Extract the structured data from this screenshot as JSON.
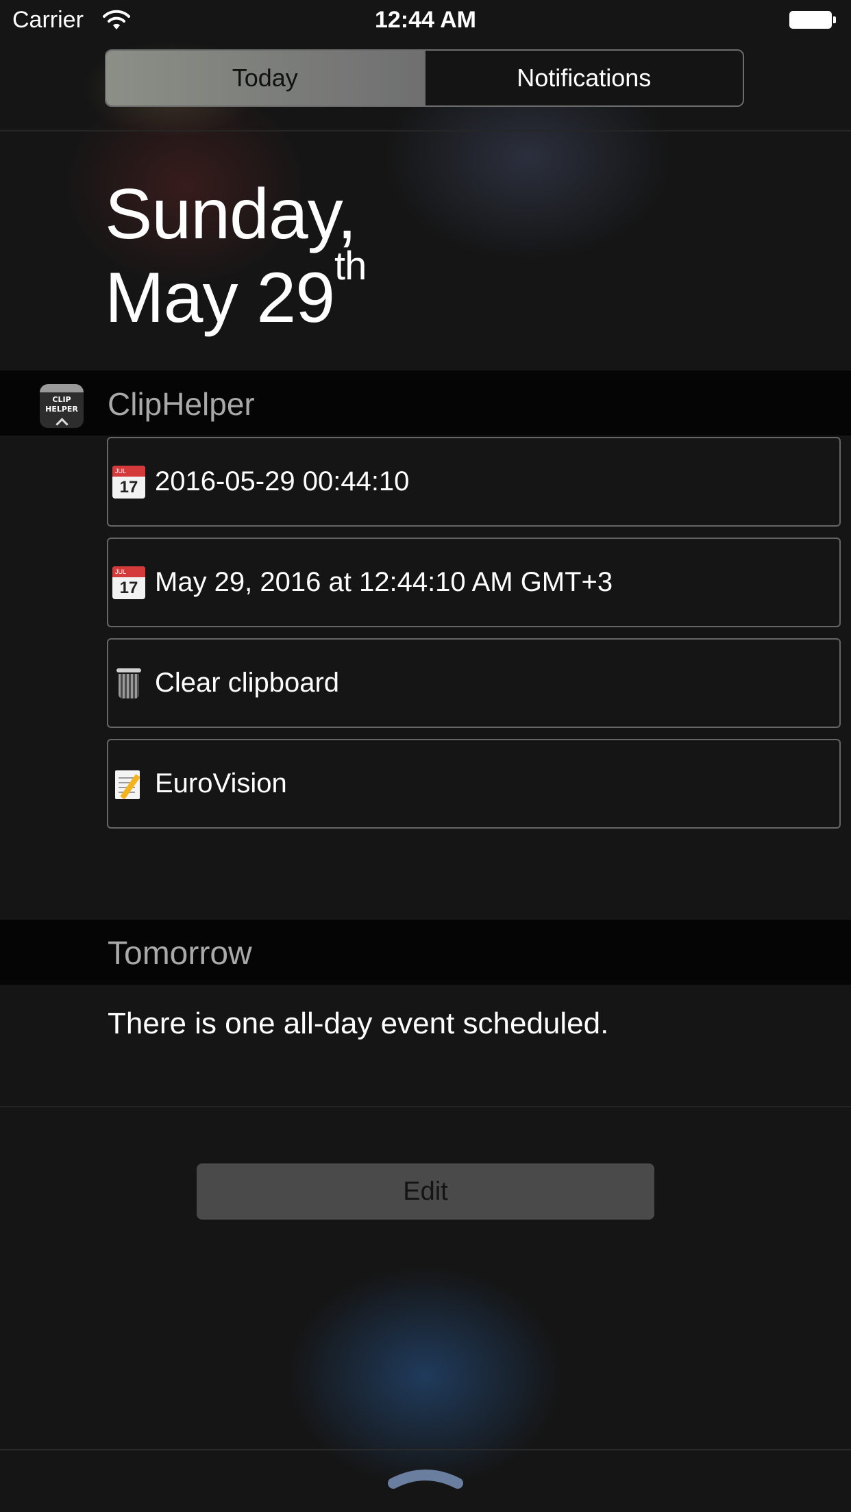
{
  "status_bar": {
    "carrier": "Carrier",
    "time": "12:44 AM"
  },
  "segmented_control": {
    "tabs": [
      {
        "label": "Today",
        "selected": true
      },
      {
        "label": "Notifications",
        "selected": false
      }
    ]
  },
  "date": {
    "weekday": "Sunday,",
    "month_day": "May 29",
    "suffix": "th"
  },
  "widget": {
    "name": "ClipHelper",
    "icon_lines": [
      "CLIP",
      "HELPER"
    ],
    "items": [
      {
        "icon": "calendar-icon",
        "icon_month": "JUL",
        "icon_day": "17",
        "label": "2016-05-29 00:44:10"
      },
      {
        "icon": "calendar-icon",
        "icon_month": "JUL",
        "icon_day": "17",
        "label": "May 29, 2016 at 12:44:10 AM GMT+3"
      },
      {
        "icon": "trash-icon",
        "label": "Clear clipboard"
      },
      {
        "icon": "memo-icon",
        "label": "EuroVision"
      }
    ]
  },
  "tomorrow": {
    "title": "Tomorrow",
    "summary": "There is one all-day event scheduled."
  },
  "edit": {
    "label": "Edit"
  },
  "colors": {
    "background": "#151515",
    "header_band": "#050505",
    "segment_active": "#8c8f87",
    "edit_button": "#4a4a4a",
    "grabber": "#6a7fa0"
  }
}
